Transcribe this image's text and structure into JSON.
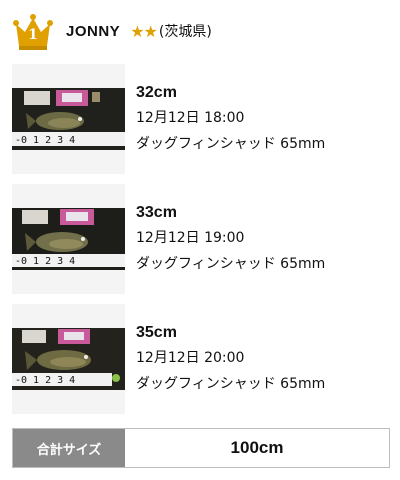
{
  "header": {
    "rank": "1",
    "crown_icon": "crown-icon",
    "crown_color": "#e0a100",
    "user_name": "JONNY",
    "stars": "★★",
    "star_count": 2,
    "prefecture": "(茨城県)"
  },
  "catches": [
    {
      "photo_icon": "fish-photo",
      "size": "32cm",
      "datetime": "12月12日 18:00",
      "lure": "ダッグフィンシャッド 65mm"
    },
    {
      "photo_icon": "fish-photo",
      "size": "33cm",
      "datetime": "12月12日 19:00",
      "lure": "ダッグフィンシャッド 65mm"
    },
    {
      "photo_icon": "fish-photo",
      "size": "35cm",
      "datetime": "12月12日 20:00",
      "lure": "ダッグフィンシャッド 65mm"
    }
  ],
  "total": {
    "label": "合計サイズ",
    "value": "100cm"
  },
  "colors": {
    "total_label_bg": "#8a8a8a",
    "star": "#e0a100"
  }
}
